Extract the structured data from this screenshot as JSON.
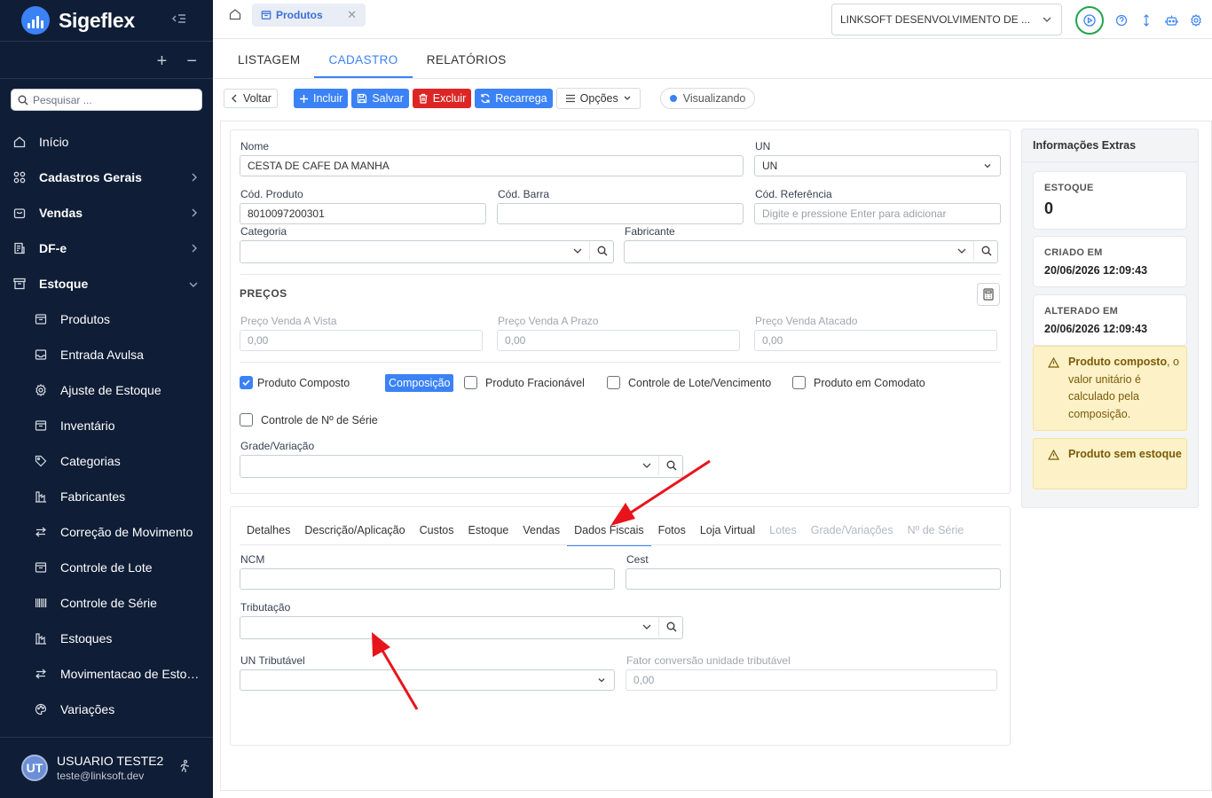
{
  "app": {
    "name": "Sigeflex"
  },
  "sidebar": {
    "search_placeholder": "Pesquisar ...",
    "items": [
      {
        "label": "Início",
        "icon": "home-icon",
        "bold": false
      },
      {
        "label": "Cadastros Gerais",
        "icon": "grid-icon",
        "bold": true
      },
      {
        "label": "Vendas",
        "icon": "bag-icon",
        "bold": true
      },
      {
        "label": "DF-e",
        "icon": "receipt-icon",
        "bold": true
      },
      {
        "label": "Estoque",
        "icon": "archive-icon",
        "bold": true
      }
    ],
    "subitems": [
      {
        "label": "Produtos",
        "icon": "archive-icon"
      },
      {
        "label": "Entrada Avulsa",
        "icon": "inbox-icon"
      },
      {
        "label": "Ajuste de Estoque",
        "icon": "gear-icon"
      },
      {
        "label": "Inventário",
        "icon": "archive-icon"
      },
      {
        "label": "Categorias",
        "icon": "tag-icon"
      },
      {
        "label": "Fabricantes",
        "icon": "factory-icon"
      },
      {
        "label": "Correção de Movimento",
        "icon": "swap-icon"
      },
      {
        "label": "Controle de Lote",
        "icon": "archive-icon"
      },
      {
        "label": "Controle de Série",
        "icon": "barcode-icon"
      },
      {
        "label": "Estoques",
        "icon": "factory-icon"
      },
      {
        "label": "Movimentacao de Esto…",
        "icon": "swap-icon"
      },
      {
        "label": "Variações",
        "icon": "palette-icon"
      }
    ]
  },
  "user": {
    "initials": "UT",
    "name": "USUARIO TESTE2",
    "email": "teste@linksoft.dev"
  },
  "topbar": {
    "tab_label": "Produtos",
    "company": "LINKSOFT DESENVOLVIMENTO DE ..."
  },
  "section_tabs": [
    "LISTAGEM",
    "CADASTRO",
    "RELATÓRIOS"
  ],
  "toolbar": {
    "back": "Voltar",
    "add": "Incluir",
    "save": "Salvar",
    "delete": "Excluir",
    "reload": "Recarrega",
    "options": "Opções",
    "status": "Visualizando"
  },
  "form": {
    "nome_label": "Nome",
    "nome_value": "CESTA DE CAFE DA MANHA",
    "un_label": "UN",
    "un_value": "UN",
    "cod_produto_label": "Cód. Produto",
    "cod_produto_value": "8010097200301",
    "cod_barra_label": "Cód. Barra",
    "cod_barra_value": "",
    "cod_ref_label": "Cód. Referência",
    "cod_ref_placeholder": "Digite e pressione Enter para adicionar",
    "categoria_label": "Categoria",
    "fabricante_label": "Fabricante",
    "precos_title": "PREÇOS",
    "preco_vista_label": "Preço Venda A Vista",
    "preco_vista_value": "0,00",
    "preco_prazo_label": "Preço Venda A Prazo",
    "preco_prazo_value": "0,00",
    "preco_atacado_label": "Preço Venda Atacado",
    "preco_atacado_value": "0,00",
    "produto_composto": "Produto Composto",
    "composicao": "Composição",
    "fracionavel": "Produto Fracionável",
    "lote": "Controle de Lote/Vencimento",
    "comodato": "Produto em Comodato",
    "serie": "Controle de Nº de Série",
    "grade_label": "Grade/Variação"
  },
  "subtabs": [
    {
      "label": "Detalhes",
      "enabled": true
    },
    {
      "label": "Descrição/Aplicação",
      "enabled": true
    },
    {
      "label": "Custos",
      "enabled": true
    },
    {
      "label": "Estoque",
      "enabled": true
    },
    {
      "label": "Vendas",
      "enabled": true
    },
    {
      "label": "Dados Fiscais",
      "enabled": true,
      "active": true
    },
    {
      "label": "Fotos",
      "enabled": true
    },
    {
      "label": "Loja Virtual",
      "enabled": true
    },
    {
      "label": "Lotes",
      "enabled": false
    },
    {
      "label": "Grade/Variações",
      "enabled": false
    },
    {
      "label": "Nº de Série",
      "enabled": false
    }
  ],
  "fiscal": {
    "ncm_label": "NCM",
    "cest_label": "Cest",
    "tributacao_label": "Tributação",
    "un_trib_label": "UN Tributável",
    "fator_label": "Fator conversão unidade tributável",
    "fator_value": "0,00"
  },
  "extras": {
    "title": "Informações Extras",
    "estoque_label": "ESTOQUE",
    "estoque_value": "0",
    "criado_label": "CRIADO EM",
    "criado_value": "20/06/2026 12:09:43",
    "alterado_label": "ALTERADO EM",
    "alterado_value": "20/06/2026 12:09:43",
    "warn1_bold": "Produto composto",
    "warn1_rest": ", o valor unitário é calculado pela composição.",
    "warn2_bold": "Produto sem estoque"
  },
  "colors": {
    "accent": "#3b82f6",
    "danger": "#dc2626",
    "sidebar_bg": "#0f1d36",
    "warning_bg": "#fdf1c8",
    "annotation_arrow": "#e8141b"
  }
}
